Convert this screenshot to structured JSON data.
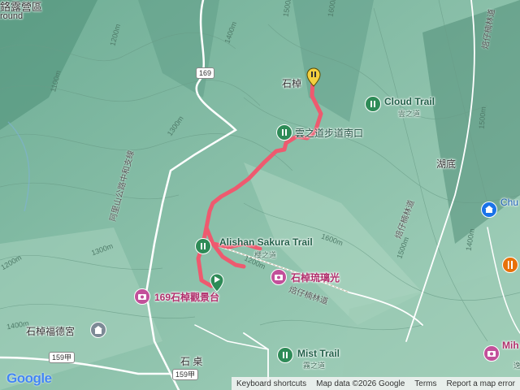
{
  "map": {
    "labels": {
      "campground": "鉻露營區",
      "ground": "round",
      "shizhuo": "石棹",
      "cloud_trail": "Cloud Trail",
      "cloud_trail_sub": "雲之道",
      "cloud_trail_south": "雲之道步道南口",
      "hudi": "湖底",
      "chu": "Chu",
      "sakura_trail": "Alishan Sakura Trail",
      "sakura_sub": "櫻之道",
      "glass_light": "石棹琉璃光",
      "viewpoint_169": "169石棹觀景台",
      "fude_temple": "石棹福德宮",
      "mist_trail": "Mist Trail",
      "mist_sub": "霧之道",
      "shizhuo_bottom": "石 桌",
      "peizi_road_1": "焙仔楠林道",
      "peizi_road_2": "焙仔楠林道",
      "alishan_branch": "阿里山公路中和支線",
      "road_right": "焙仔楠林道",
      "mih": "Mih",
      "yi": "逸"
    },
    "shields": {
      "r169": "169",
      "r159a_1": "159甲",
      "r159a_2": "159甲"
    },
    "contours": [
      "1200m",
      "1100m",
      "1300m",
      "1400m",
      "1500m",
      "1600m",
      "1600m",
      "1500m",
      "1400m",
      "1500m",
      "1200m",
      "1300m",
      "1200m",
      "1400m"
    ],
    "attribution": {
      "keyboard": "Keyboard shortcuts",
      "data": "Map data ©2026 Google",
      "terms": "Terms",
      "report": "Report a map error"
    },
    "logo": "Google",
    "colors": {
      "track": "#ee5a6f",
      "terrain": "#8fc4ac",
      "end_marker": "#f4d03f",
      "start_marker": "#2e8b57"
    }
  }
}
